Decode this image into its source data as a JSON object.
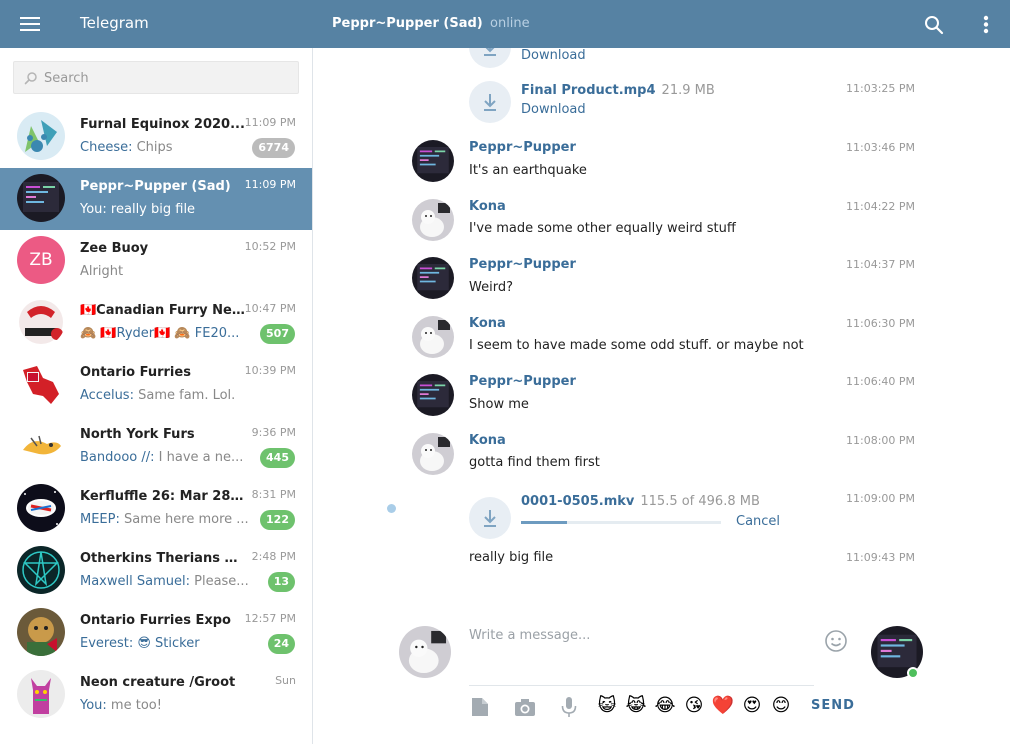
{
  "app": {
    "title": "Telegram"
  },
  "header": {
    "chat_title": "Peppr~Pupper (Sad)",
    "status": "online",
    "accent": "#5682a3"
  },
  "search": {
    "placeholder": "Search"
  },
  "dialogs": [
    {
      "name": "Furnal Equinox 2020...",
      "time": "11:09 PM",
      "sender": "Cheese:",
      "preview": " Chips",
      "badge": "6774",
      "badge_muted": true
    },
    {
      "name": "Peppr~Pupper (Sad)",
      "time": "11:09 PM",
      "sender": "You:",
      "preview": " really big file",
      "badge": "",
      "active": true
    },
    {
      "name": "Zee Buoy",
      "time": "10:52 PM",
      "sender": "",
      "preview": "Alright",
      "badge": "",
      "initials": "ZB"
    },
    {
      "name": "🇨🇦Canadian Furry Ne...",
      "time": "10:47 PM",
      "sender": "",
      "preview": "🙈 🇨🇦Ryder🇨🇦 🙈 FE20...",
      "badge": "507"
    },
    {
      "name": "Ontario Furries",
      "time": "10:39 PM",
      "sender": "Accelus:",
      "preview": " Same fam. Lol.",
      "badge": ""
    },
    {
      "name": "North York Furs",
      "time": "9:36 PM",
      "sender": "Bandooo //:",
      "preview": " I have a ne...",
      "badge": "445"
    },
    {
      "name": "Kerfluffle 26: Mar 28t...",
      "time": "8:31 PM",
      "sender": "MEEP:",
      "preview": " Same here more ...",
      "badge": "122"
    },
    {
      "name": "Otherkins Therians U...",
      "time": "2:48 PM",
      "sender": "Maxwell Samuel:",
      "preview": " Please...",
      "badge": "13"
    },
    {
      "name": "Ontario Furries Expo",
      "time": "12:57 PM",
      "sender": "Everest:",
      "preview": " 😎 Sticker",
      "badge": "24"
    },
    {
      "name": "Neon creature /Groot",
      "time": "Sun",
      "sender": "You:",
      "preview": " me too!",
      "badge": ""
    }
  ],
  "messages": {
    "doc1": {
      "link": "Download"
    },
    "doc2": {
      "name": "Final Product.mp4",
      "size": "21.9 MB",
      "link": "Download",
      "time": "11:03:25 PM"
    },
    "m1": {
      "author": "Peppr~Pupper",
      "text": "It's an earthquake",
      "time": "11:03:46 PM"
    },
    "m2": {
      "author": "Kona",
      "text": "I've made some other equally weird stuff",
      "time": "11:04:22 PM"
    },
    "m3": {
      "author": "Peppr~Pupper",
      "text": "Weird?",
      "time": "11:04:37 PM"
    },
    "m4": {
      "author": "Kona",
      "text": "I seem to have made some odd stuff. or  maybe not",
      "time": "11:06:30 PM"
    },
    "m5": {
      "author": "Peppr~Pupper",
      "text": "Show me",
      "time": "11:06:40 PM"
    },
    "m6": {
      "author": "Kona",
      "text": "gotta find them first",
      "time": "11:08:00 PM"
    },
    "upload": {
      "name": "0001-0505.mkv",
      "size": "115.5 of 496.8 MB",
      "cancel": "Cancel",
      "time": "11:09:00 PM",
      "progress": 0.23
    },
    "m7": {
      "text": "really big file",
      "time": "11:09:43 PM"
    }
  },
  "composer": {
    "placeholder": "Write a message...",
    "send_label": "SEND",
    "emojis": [
      "😺",
      "😹",
      "😂",
      "😘",
      "❤️",
      "😍",
      "😊"
    ]
  }
}
